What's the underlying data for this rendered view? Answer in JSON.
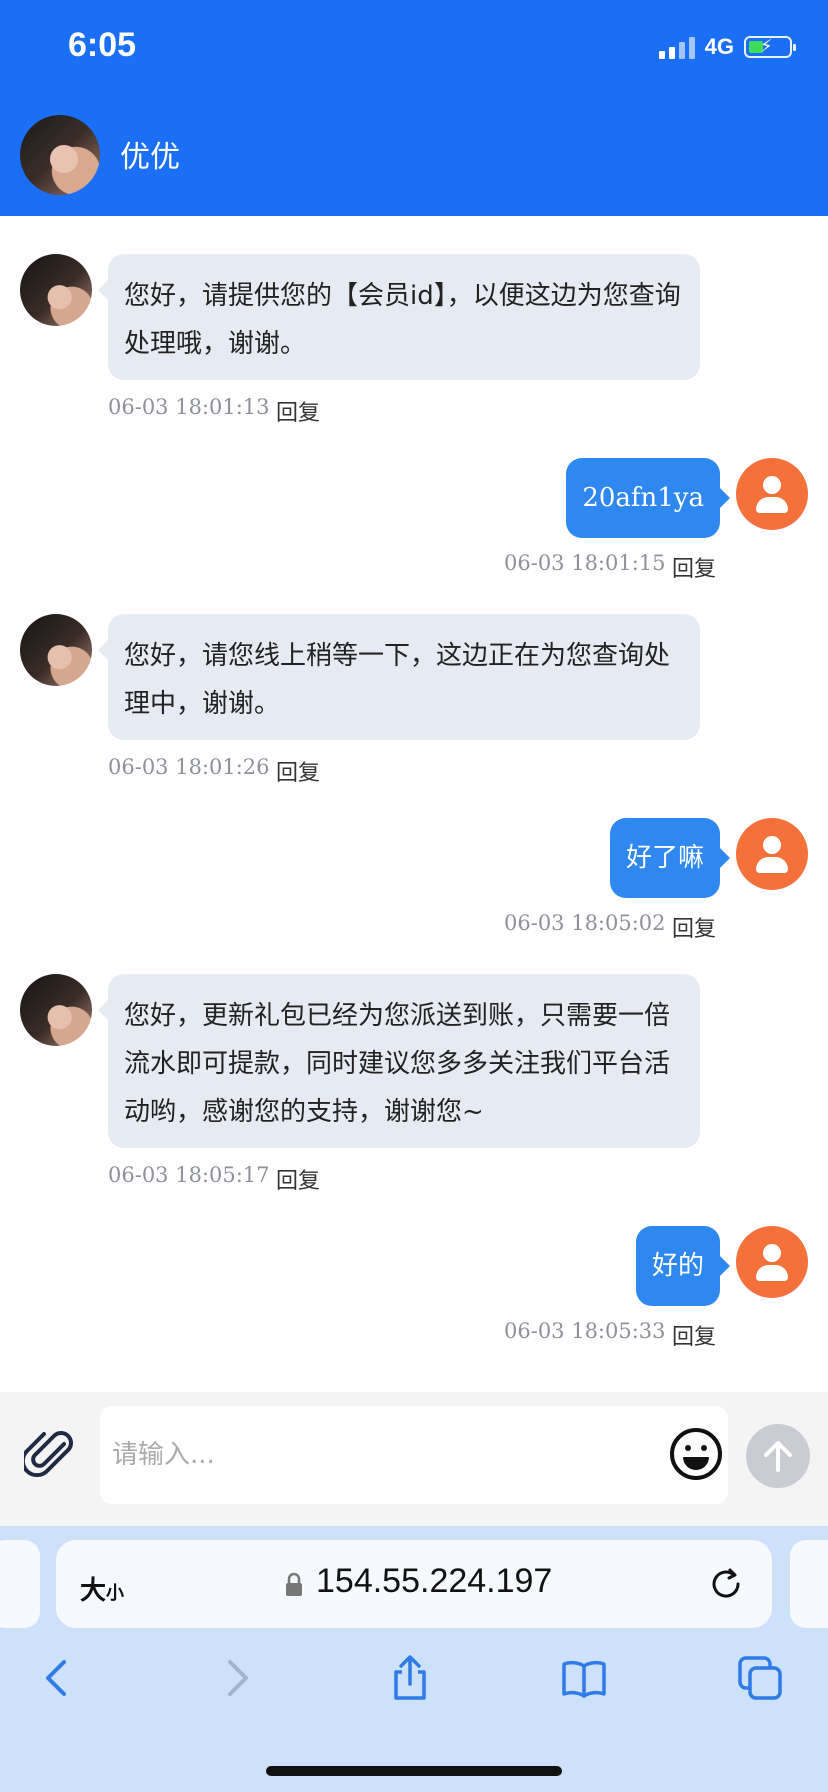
{
  "status_bar": {
    "time": "6:05",
    "network": "4G"
  },
  "header": {
    "title": "优优"
  },
  "messages": [
    {
      "side": "left",
      "text": "您好，请提供您的【会员id】，以便这边为您查询处理哦，谢谢。",
      "time": "06-03 18:01:13",
      "reply": "回复"
    },
    {
      "side": "right",
      "text": "20afn1ya",
      "time": "06-03 18:01:15",
      "reply": "回复"
    },
    {
      "side": "left",
      "text": "您好，请您线上稍等一下，这边正在为您查询处理中，谢谢。",
      "time": "06-03 18:01:26",
      "reply": "回复"
    },
    {
      "side": "right",
      "text": "好了嘛",
      "time": "06-03 18:05:02",
      "reply": "回复"
    },
    {
      "side": "left",
      "text": "您好，更新礼包已经为您派送到账，只需要一倍流水即可提款，同时建议您多多关注我们平台活动哟，感谢您的支持，谢谢您~",
      "time": "06-03 18:05:17",
      "reply": "回复"
    },
    {
      "side": "right",
      "text": "好的",
      "time": "06-03 18:05:33",
      "reply": "回复"
    }
  ],
  "input": {
    "placeholder": "请输入..."
  },
  "browser": {
    "text_size_big": "大",
    "text_size_small": "小",
    "url": "154.55.224.197"
  },
  "colors": {
    "header": "#1a6ff6",
    "bubble_right": "#2f88f0",
    "bubble_left": "#e6eaf2",
    "user_avatar": "#f5713c"
  }
}
